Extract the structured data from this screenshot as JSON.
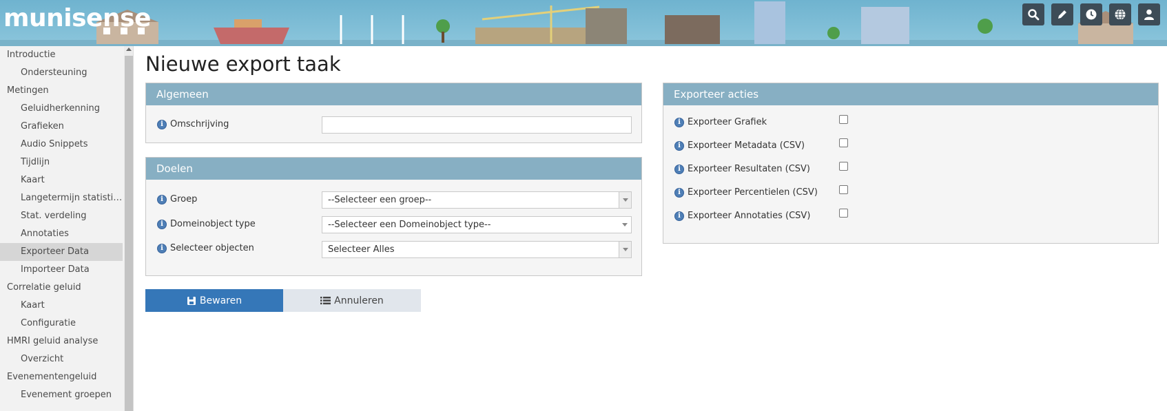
{
  "header": {
    "logo": "munisense",
    "icons": [
      "search-icon",
      "pencil-icon",
      "clock-icon",
      "globe-icon",
      "user-icon"
    ]
  },
  "sidebar": {
    "items": [
      {
        "label": "Introductie",
        "level": 0
      },
      {
        "label": "Ondersteuning",
        "level": 1
      },
      {
        "label": "Metingen",
        "level": 0
      },
      {
        "label": "Geluidherkenning",
        "level": 1
      },
      {
        "label": "Grafieken",
        "level": 1
      },
      {
        "label": "Audio Snippets",
        "level": 1
      },
      {
        "label": "Tijdlijn",
        "level": 1
      },
      {
        "label": "Kaart",
        "level": 1
      },
      {
        "label": "Langetermijn statistieken",
        "level": 1
      },
      {
        "label": "Stat. verdeling",
        "level": 1
      },
      {
        "label": "Annotaties",
        "level": 1
      },
      {
        "label": "Exporteer Data",
        "level": 1,
        "active": true
      },
      {
        "label": "Importeer Data",
        "level": 1
      },
      {
        "label": "Correlatie geluid",
        "level": 0
      },
      {
        "label": "Kaart",
        "level": 1
      },
      {
        "label": "Configuratie",
        "level": 1
      },
      {
        "label": "HMRI geluid analyse",
        "level": 0
      },
      {
        "label": "Overzicht",
        "level": 1
      },
      {
        "label": "Evenementengeluid",
        "level": 0
      },
      {
        "label": "Evenement groepen",
        "level": 1
      }
    ]
  },
  "main": {
    "title": "Nieuwe export taak",
    "algemeen": {
      "heading": "Algemeen",
      "omschrijving_label": "Omschrijving",
      "omschrijving_value": ""
    },
    "doelen": {
      "heading": "Doelen",
      "groep_label": "Groep",
      "groep_value": "--Selecteer een groep--",
      "domeinobject_label": "Domeinobject type",
      "domeinobject_value": "--Selecteer een Domeinobject type--",
      "objecten_label": "Selecteer objecten",
      "objecten_value": "Selecteer Alles"
    },
    "acties": {
      "heading": "Exporteer acties",
      "items": [
        {
          "label": "Exporteer Grafiek",
          "checked": false
        },
        {
          "label": "Exporteer Metadata (CSV)",
          "checked": false
        },
        {
          "label": "Exporteer Resultaten (CSV)",
          "checked": false
        },
        {
          "label": "Exporteer Percentielen (CSV)",
          "checked": false
        },
        {
          "label": "Exporteer Annotaties (CSV)",
          "checked": false
        }
      ]
    },
    "buttons": {
      "save_label": "Bewaren",
      "cancel_label": "Annuleren"
    }
  },
  "colors": {
    "header_bg": "#7fbcd5",
    "panel_head": "#87afc3",
    "primary_button": "#3577b8",
    "secondary_button": "#e1e6ec",
    "icon_button": "#3d4c57"
  }
}
